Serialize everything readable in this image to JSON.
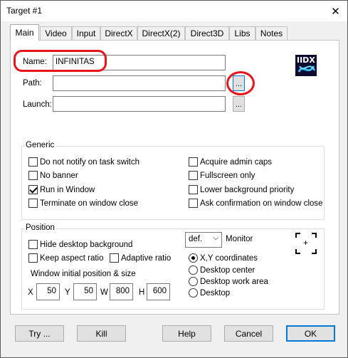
{
  "window": {
    "title": "Target #1",
    "close_glyph": "✕"
  },
  "tabs": [
    {
      "label": "Main",
      "active": true
    },
    {
      "label": "Video"
    },
    {
      "label": "Input"
    },
    {
      "label": "DirectX"
    },
    {
      "label": "DirectX(2)"
    },
    {
      "label": "Direct3D"
    },
    {
      "label": "Libs"
    },
    {
      "label": "Notes"
    }
  ],
  "main": {
    "name_label": "Name:",
    "name_value": "INFINITAS",
    "path_label": "Path:",
    "path_value": "",
    "launch_label": "Launch:",
    "launch_value": "",
    "browse_label": "...",
    "app_icon": {
      "name": "iidx-logo-icon",
      "text": "IIDX"
    }
  },
  "generic": {
    "title": "Generic",
    "options": [
      {
        "label": "Do not notify on task switch",
        "checked": false
      },
      {
        "label": "No banner",
        "checked": false
      },
      {
        "label": "Run in Window",
        "checked": true
      },
      {
        "label": "Terminate on window close",
        "checked": false
      },
      {
        "label": "Acquire admin caps",
        "checked": false
      },
      {
        "label": "Fullscreen only",
        "checked": false
      },
      {
        "label": "Lower background priority",
        "checked": false
      },
      {
        "label": "Ask confirmation on window close",
        "checked": false
      }
    ]
  },
  "position": {
    "title": "Position",
    "hide_desktop_background": {
      "label": "Hide desktop background",
      "checked": false
    },
    "keep_aspect_ratio": {
      "label": "Keep aspect ratio",
      "checked": false
    },
    "adaptive_ratio": {
      "label": "Adaptive ratio",
      "checked": false
    },
    "monitor_label": "Monitor",
    "monitor_selected": "def.",
    "initial_label": "Window initial position & size",
    "fields": [
      {
        "label": "X",
        "value": "50"
      },
      {
        "label": "Y",
        "value": "50"
      },
      {
        "label": "W",
        "value": "800"
      },
      {
        "label": "H",
        "value": "600"
      }
    ],
    "modes": [
      {
        "label": "X,Y coordinates",
        "selected": true
      },
      {
        "label": "Desktop center",
        "selected": false
      },
      {
        "label": "Desktop work area",
        "selected": false
      },
      {
        "label": "Desktop",
        "selected": false
      }
    ],
    "monitor_preview_text": "+"
  },
  "buttons": {
    "try": "Try ...",
    "kill": "Kill",
    "help": "Help",
    "cancel": "Cancel",
    "ok": "OK"
  }
}
